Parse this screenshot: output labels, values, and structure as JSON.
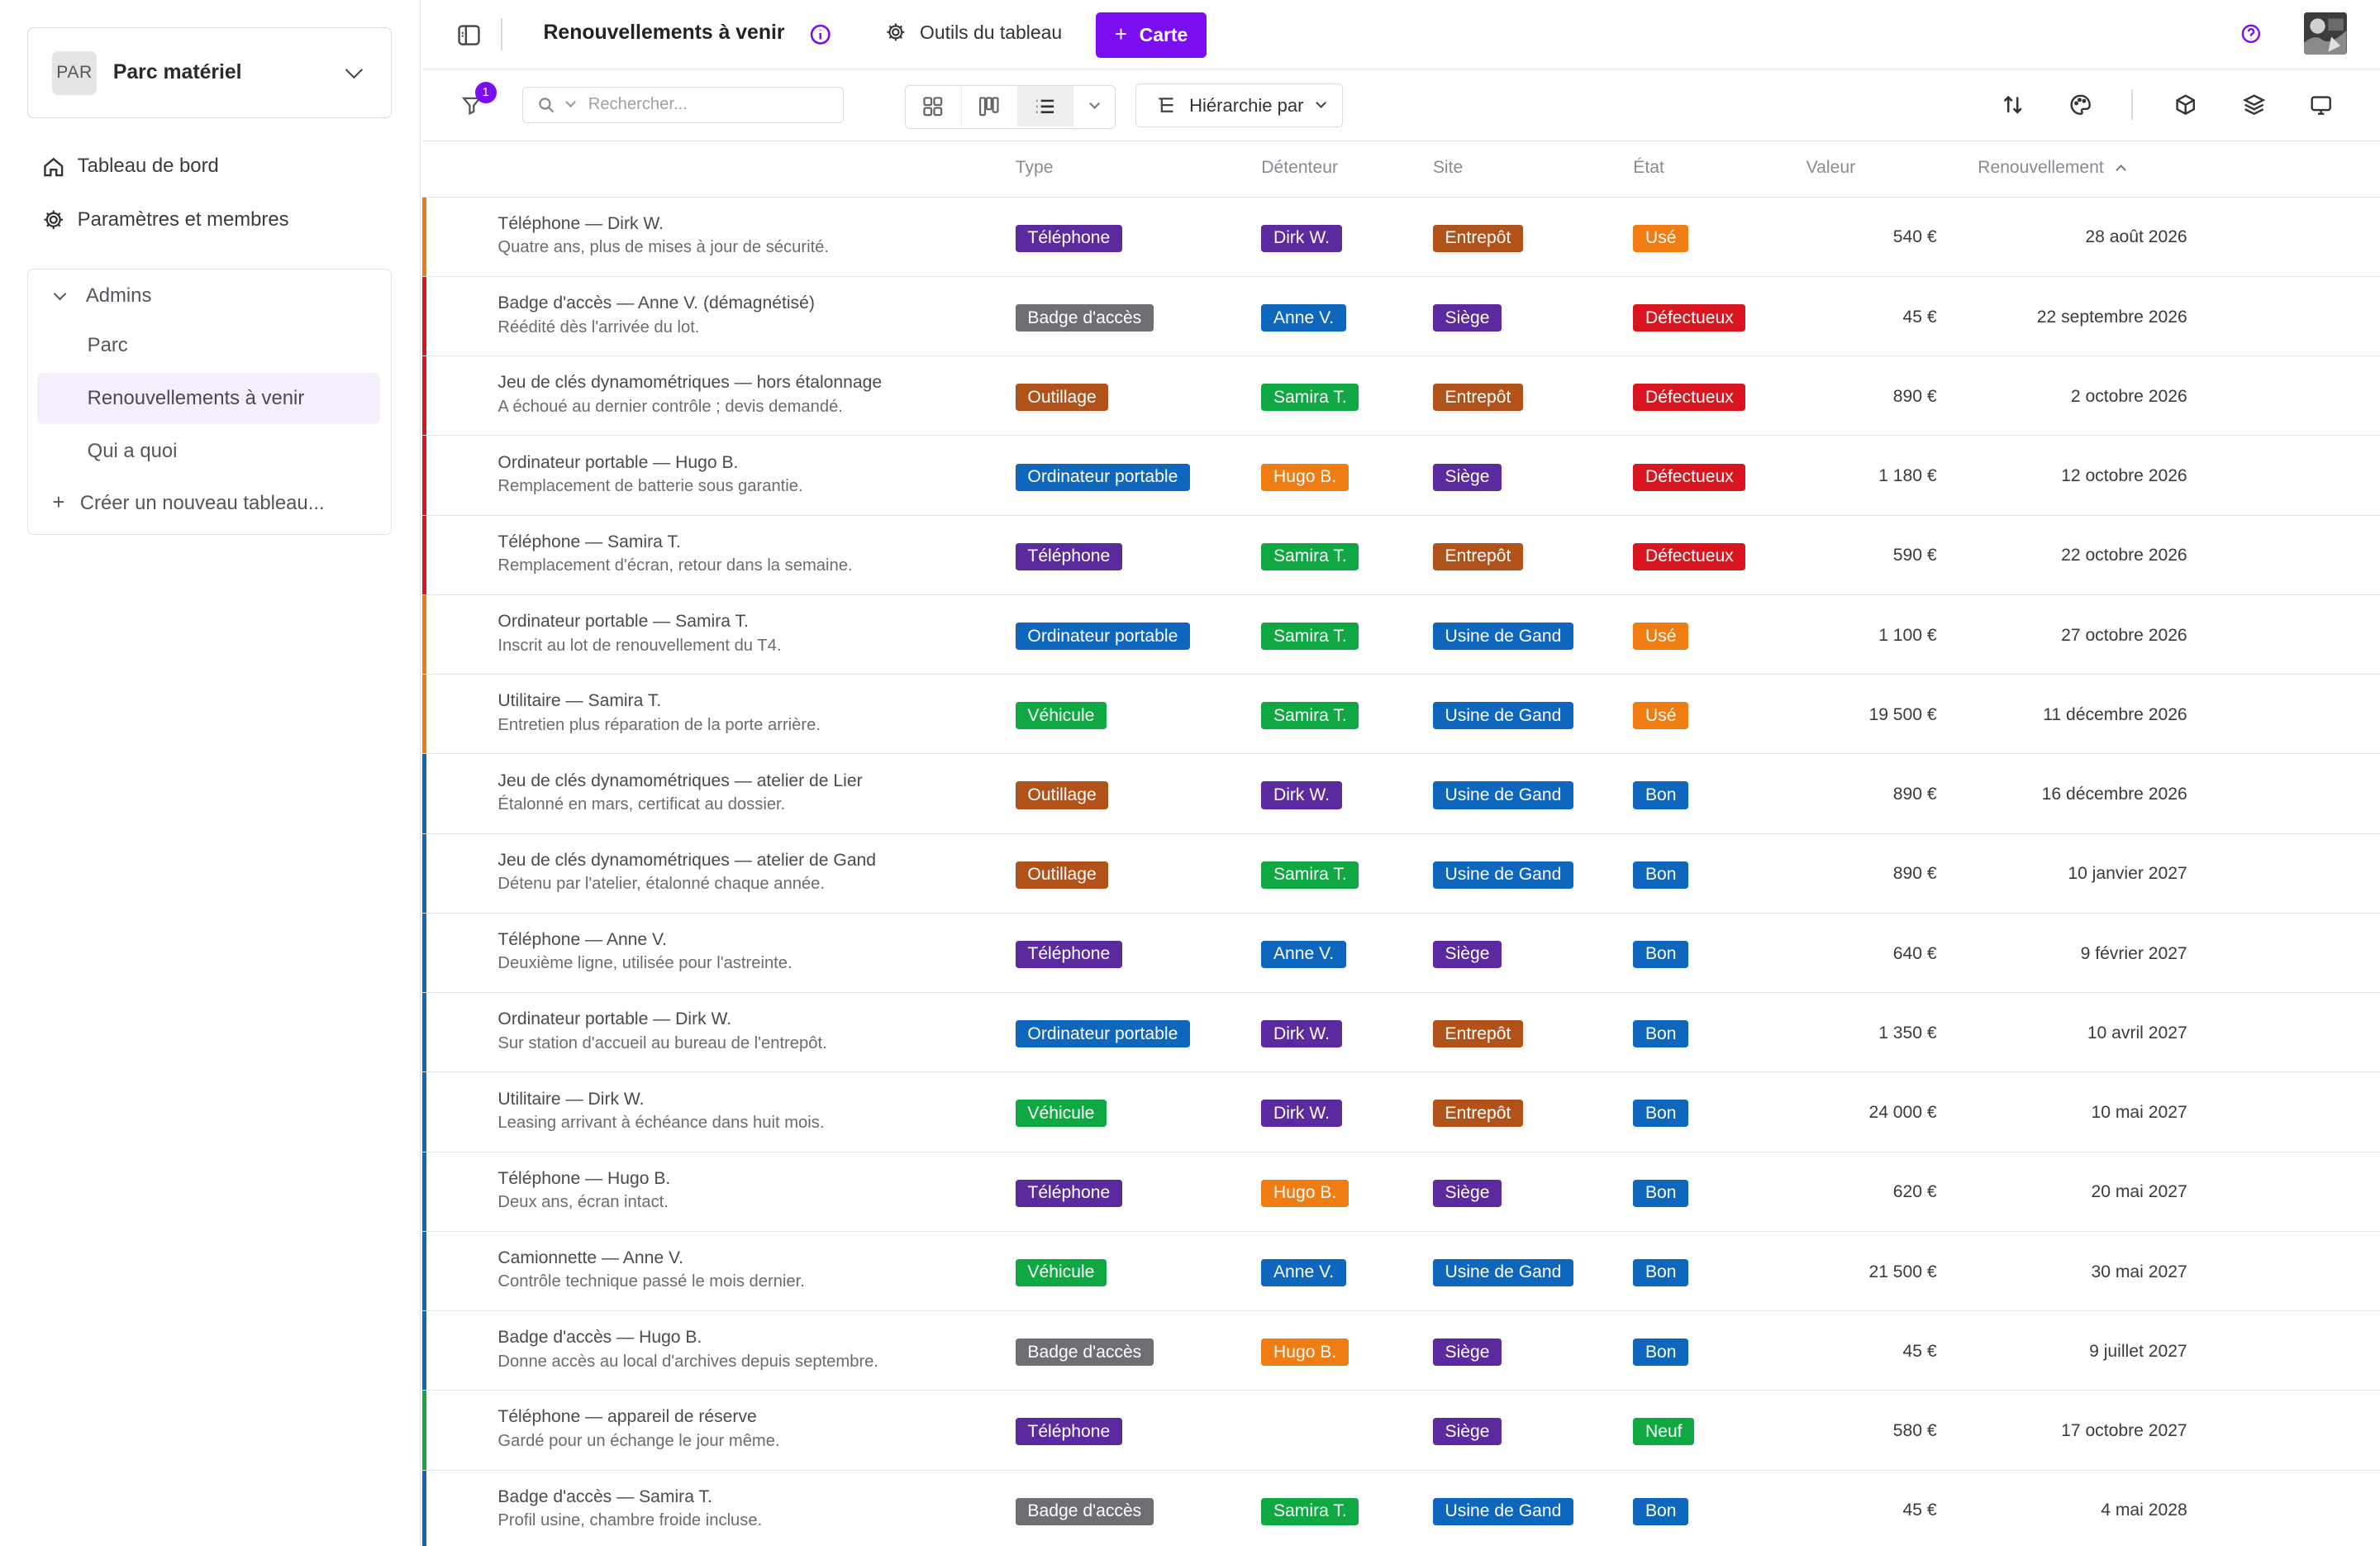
{
  "workspace": {
    "avatar": "PAR",
    "name": "Parc matériel"
  },
  "nav": {
    "dashboard": "Tableau de bord",
    "settings": "Paramètres et membres"
  },
  "group": {
    "title": "Admins",
    "items": [
      "Parc",
      "Renouvellements à venir",
      "Qui a quoi"
    ],
    "active_index": 1,
    "new_label": "Créer un nouveau tableau..."
  },
  "topbar": {
    "title": "Renouvellements à venir",
    "tools": "Outils du tableau",
    "add_button": "Carte"
  },
  "toolbar": {
    "filter_count": "1",
    "search_placeholder": "Rechercher...",
    "hierarchy": "Hiérarchie par"
  },
  "columns": {
    "type": "Type",
    "owner": "Détenteur",
    "site": "Site",
    "state": "État",
    "value": "Valeur",
    "renewal": "Renouvellement"
  },
  "colors": {
    "accent": "#7a0ef0",
    "Téléphone": "#5b2a9f",
    "Badge d'accès": "#6e6e73",
    "Outillage": "#b0521a",
    "Ordinateur portable": "#0f66bd",
    "Véhicule": "#10a843",
    "Dirk W.": "#5b2a9f",
    "Anne V.": "#0f66bd",
    "Samira T.": "#10a843",
    "Hugo B.": "#f07c14",
    "Entrepôt": "#b0521a",
    "Siège": "#5b2a9f",
    "Usine de Gand": "#0f66bd",
    "Usé": "#f07c14",
    "Défectueux": "#d9161f",
    "Bon": "#0f66bd",
    "Neuf": "#10a843"
  },
  "rows": [
    {
      "name": "Téléphone — Dirk W.",
      "desc": "Quatre ans, plus de mises à jour de sécurité.",
      "type": "Téléphone",
      "owner": "Dirk W.",
      "site": "Entrepôt",
      "state": "Usé",
      "value": "540 €",
      "renewal": "28 août 2026"
    },
    {
      "name": "Badge d'accès — Anne V. (démagnétisé)",
      "desc": "Réédité dès l'arrivée du lot.",
      "type": "Badge d'accès",
      "owner": "Anne V.",
      "site": "Siège",
      "state": "Défectueux",
      "value": "45 €",
      "renewal": "22 septembre 2026"
    },
    {
      "name": "Jeu de clés dynamométriques — hors étalonnage",
      "desc": "A échoué au dernier contrôle ; devis demandé.",
      "type": "Outillage",
      "owner": "Samira T.",
      "site": "Entrepôt",
      "state": "Défectueux",
      "value": "890 €",
      "renewal": "2 octobre 2026"
    },
    {
      "name": "Ordinateur portable — Hugo B.",
      "desc": "Remplacement de batterie sous garantie.",
      "type": "Ordinateur portable",
      "owner": "Hugo B.",
      "site": "Siège",
      "state": "Défectueux",
      "value": "1 180 €",
      "renewal": "12 octobre 2026"
    },
    {
      "name": "Téléphone — Samira T.",
      "desc": "Remplacement d'écran, retour dans la semaine.",
      "type": "Téléphone",
      "owner": "Samira T.",
      "site": "Entrepôt",
      "state": "Défectueux",
      "value": "590 €",
      "renewal": "22 octobre 2026"
    },
    {
      "name": "Ordinateur portable — Samira T.",
      "desc": "Inscrit au lot de renouvellement du T4.",
      "type": "Ordinateur portable",
      "owner": "Samira T.",
      "site": "Usine de Gand",
      "state": "Usé",
      "value": "1 100 €",
      "renewal": "27 octobre 2026"
    },
    {
      "name": "Utilitaire — Samira T.",
      "desc": "Entretien plus réparation de la porte arrière.",
      "type": "Véhicule",
      "owner": "Samira T.",
      "site": "Usine de Gand",
      "state": "Usé",
      "value": "19 500 €",
      "renewal": "11 décembre 2026"
    },
    {
      "name": "Jeu de clés dynamométriques — atelier de Lier",
      "desc": "Étalonné en mars, certificat au dossier.",
      "type": "Outillage",
      "owner": "Dirk W.",
      "site": "Usine de Gand",
      "state": "Bon",
      "value": "890 €",
      "renewal": "16 décembre 2026"
    },
    {
      "name": "Jeu de clés dynamométriques — atelier de Gand",
      "desc": "Détenu par l'atelier, étalonné chaque année.",
      "type": "Outillage",
      "owner": "Samira T.",
      "site": "Usine de Gand",
      "state": "Bon",
      "value": "890 €",
      "renewal": "10 janvier 2027"
    },
    {
      "name": "Téléphone — Anne V.",
      "desc": "Deuxième ligne, utilisée pour l'astreinte.",
      "type": "Téléphone",
      "owner": "Anne V.",
      "site": "Siège",
      "state": "Bon",
      "value": "640 €",
      "renewal": "9 février 2027"
    },
    {
      "name": "Ordinateur portable — Dirk W.",
      "desc": "Sur station d'accueil au bureau de l'entrepôt.",
      "type": "Ordinateur portable",
      "owner": "Dirk W.",
      "site": "Entrepôt",
      "state": "Bon",
      "value": "1 350 €",
      "renewal": "10 avril 2027"
    },
    {
      "name": "Utilitaire — Dirk W.",
      "desc": "Leasing arrivant à échéance dans huit mois.",
      "type": "Véhicule",
      "owner": "Dirk W.",
      "site": "Entrepôt",
      "state": "Bon",
      "value": "24 000 €",
      "renewal": "10 mai 2027"
    },
    {
      "name": "Téléphone — Hugo B.",
      "desc": "Deux ans, écran intact.",
      "type": "Téléphone",
      "owner": "Hugo B.",
      "site": "Siège",
      "state": "Bon",
      "value": "620 €",
      "renewal": "20 mai 2027"
    },
    {
      "name": "Camionnette — Anne V.",
      "desc": "Contrôle technique passé le mois dernier.",
      "type": "Véhicule",
      "owner": "Anne V.",
      "site": "Usine de Gand",
      "state": "Bon",
      "value": "21 500 €",
      "renewal": "30 mai 2027"
    },
    {
      "name": "Badge d'accès — Hugo B.",
      "desc": "Donne accès au local d'archives depuis septembre.",
      "type": "Badge d'accès",
      "owner": "Hugo B.",
      "site": "Siège",
      "state": "Bon",
      "value": "45 €",
      "renewal": "9 juillet 2027"
    },
    {
      "name": "Téléphone — appareil de réserve",
      "desc": "Gardé pour un échange le jour même.",
      "type": "Téléphone",
      "owner": "",
      "site": "Siège",
      "state": "Neuf",
      "value": "580 €",
      "renewal": "17 octobre 2027"
    },
    {
      "name": "Badge d'accès — Samira T.",
      "desc": "Profil usine, chambre froide incluse.",
      "type": "Badge d'accès",
      "owner": "Samira T.",
      "site": "Usine de Gand",
      "state": "Bon",
      "value": "45 €",
      "renewal": "4 mai 2028"
    }
  ]
}
